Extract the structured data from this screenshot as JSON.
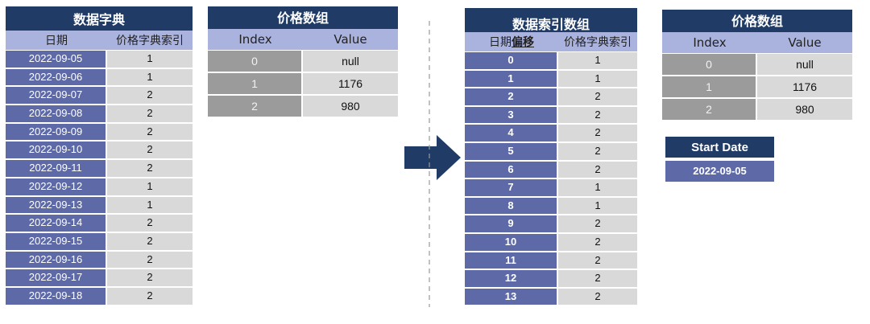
{
  "date_dict": {
    "title": "数据字典",
    "col_date": "日期",
    "col_index": "价格字典索引",
    "rows": [
      {
        "date": "2022-09-05",
        "idx": "1"
      },
      {
        "date": "2022-09-06",
        "idx": "1"
      },
      {
        "date": "2022-09-07",
        "idx": "2"
      },
      {
        "date": "2022-09-08",
        "idx": "2"
      },
      {
        "date": "2022-09-09",
        "idx": "2"
      },
      {
        "date": "2022-09-10",
        "idx": "2"
      },
      {
        "date": "2022-09-11",
        "idx": "2"
      },
      {
        "date": "2022-09-12",
        "idx": "1"
      },
      {
        "date": "2022-09-13",
        "idx": "1"
      },
      {
        "date": "2022-09-14",
        "idx": "2"
      },
      {
        "date": "2022-09-15",
        "idx": "2"
      },
      {
        "date": "2022-09-16",
        "idx": "2"
      },
      {
        "date": "2022-09-17",
        "idx": "2"
      },
      {
        "date": "2022-09-18",
        "idx": "2"
      }
    ]
  },
  "price_array_left": {
    "title": "价格数组",
    "col_index": "Index",
    "col_value": "Value",
    "rows": [
      {
        "i": "0",
        "v": "null"
      },
      {
        "i": "1",
        "v": "1176"
      },
      {
        "i": "2",
        "v": "980"
      }
    ]
  },
  "index_array": {
    "title": "数据索引数组",
    "col_date_a": "日期",
    "col_date_b": "偏移",
    "col_index": "价格字典索引",
    "rows": [
      {
        "o": "0",
        "idx": "1"
      },
      {
        "o": "1",
        "idx": "1"
      },
      {
        "o": "2",
        "idx": "2"
      },
      {
        "o": "3",
        "idx": "2"
      },
      {
        "o": "4",
        "idx": "2"
      },
      {
        "o": "5",
        "idx": "2"
      },
      {
        "o": "6",
        "idx": "2"
      },
      {
        "o": "7",
        "idx": "1"
      },
      {
        "o": "8",
        "idx": "1"
      },
      {
        "o": "9",
        "idx": "2"
      },
      {
        "o": "10",
        "idx": "2"
      },
      {
        "o": "11",
        "idx": "2"
      },
      {
        "o": "12",
        "idx": "2"
      },
      {
        "o": "13",
        "idx": "2"
      }
    ]
  },
  "price_array_right": {
    "title": "价格数组",
    "col_index": "Index",
    "col_value": "Value",
    "rows": [
      {
        "i": "0",
        "v": "null"
      },
      {
        "i": "1",
        "v": "1176"
      },
      {
        "i": "2",
        "v": "980"
      }
    ]
  },
  "start_date": {
    "label": "Start Date",
    "value": "2022-09-05"
  },
  "colors": {
    "title_bg": "#1f3b66",
    "header_bg": "#aab2de",
    "key_cell": "#5d6aa7",
    "value_cell": "#d9d9d9",
    "grey_key_cell": "#9b9b9b",
    "arrow": "#1f3b66"
  }
}
